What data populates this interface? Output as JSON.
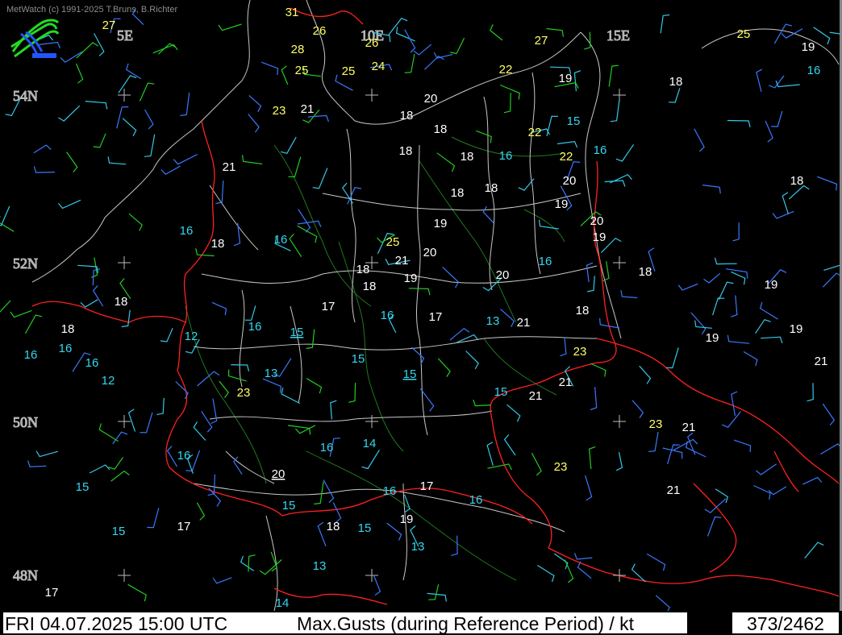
{
  "header": {
    "credit": "MetWatch  (c) 1991-2025 T.Bruns, B.Richter",
    "logo_icon": "metwatch-logo-icon"
  },
  "status_bar": {
    "datetime": "FRI 04.07.2025 15:00 UTC",
    "title": "Max.Gusts (during Reference Period) / kt",
    "counter": "373/2462"
  },
  "colors": {
    "background": "#000000",
    "border": "#ff2020",
    "coast": "#c8c8c8",
    "river": "#1f7a1f",
    "white_label": "#ffffff",
    "cyan_label": "#33d6f0",
    "yellow_label": "#ffff66",
    "barb_green": "#22cc22",
    "barb_blue": "#3a78ff",
    "barb_cyan": "#33c8e8"
  },
  "grid": {
    "lon_labels": [
      "5E",
      "10E",
      "15E"
    ],
    "lat_labels": [
      "54N",
      "52N",
      "50N",
      "48N"
    ]
  },
  "stations": [
    {
      "v": "31",
      "c": "y"
    },
    {
      "v": "27",
      "c": "y"
    },
    {
      "v": "26",
      "c": "y"
    },
    {
      "v": "26",
      "c": "y"
    },
    {
      "v": "27",
      "c": "y"
    },
    {
      "v": "25",
      "c": "y"
    },
    {
      "v": "19",
      "c": "w"
    },
    {
      "v": "28",
      "c": "y"
    },
    {
      "v": "25",
      "c": "y"
    },
    {
      "v": "25",
      "c": "y"
    },
    {
      "v": "24",
      "c": "y"
    },
    {
      "v": "22",
      "c": "y"
    },
    {
      "v": "16",
      "c": "c"
    },
    {
      "v": "19",
      "c": "w"
    },
    {
      "v": "18",
      "c": "w"
    },
    {
      "v": "20",
      "c": "w"
    },
    {
      "v": "23",
      "c": "y"
    },
    {
      "v": "21",
      "c": "w"
    },
    {
      "v": "18",
      "c": "w"
    },
    {
      "v": "15",
      "c": "c"
    },
    {
      "v": "18",
      "c": "w"
    },
    {
      "v": "22",
      "c": "y"
    },
    {
      "v": "18",
      "c": "w"
    },
    {
      "v": "18",
      "c": "w"
    },
    {
      "v": "16",
      "c": "c"
    },
    {
      "v": "22",
      "c": "y"
    },
    {
      "v": "16",
      "c": "c"
    },
    {
      "v": "21",
      "c": "w"
    },
    {
      "v": "20",
      "c": "w"
    },
    {
      "v": "18",
      "c": "w"
    },
    {
      "v": "18",
      "c": "w"
    },
    {
      "v": "18",
      "c": "w"
    },
    {
      "v": "19",
      "c": "w"
    },
    {
      "v": "19",
      "c": "w"
    },
    {
      "v": "20",
      "c": "w"
    },
    {
      "v": "16",
      "c": "c"
    },
    {
      "v": "19",
      "c": "w"
    },
    {
      "v": "18",
      "c": "w"
    },
    {
      "v": "16",
      "c": "c"
    },
    {
      "v": "25",
      "c": "y"
    },
    {
      "v": "20",
      "c": "w"
    },
    {
      "v": "21",
      "c": "w"
    },
    {
      "v": "18",
      "c": "w"
    },
    {
      "v": "16",
      "c": "c"
    },
    {
      "v": "18",
      "c": "w"
    },
    {
      "v": "20",
      "c": "w"
    },
    {
      "v": "18",
      "c": "w"
    },
    {
      "v": "19",
      "c": "w"
    },
    {
      "v": "19",
      "c": "w"
    },
    {
      "v": "18",
      "c": "w"
    },
    {
      "v": "17",
      "c": "w"
    },
    {
      "v": "16",
      "c": "c"
    },
    {
      "v": "17",
      "c": "w"
    },
    {
      "v": "13",
      "c": "c"
    },
    {
      "v": "21",
      "c": "w"
    },
    {
      "v": "18",
      "c": "w"
    },
    {
      "v": "18",
      "c": "w"
    },
    {
      "v": "19",
      "c": "w"
    },
    {
      "v": "19",
      "c": "w"
    },
    {
      "v": "16",
      "c": "c"
    },
    {
      "v": "15",
      "c": "c",
      "u": true
    },
    {
      "v": "12",
      "c": "c"
    },
    {
      "v": "16",
      "c": "c"
    },
    {
      "v": "16",
      "c": "c"
    },
    {
      "v": "16",
      "c": "c"
    },
    {
      "v": "15",
      "c": "c"
    },
    {
      "v": "23",
      "c": "y"
    },
    {
      "v": "21",
      "c": "w"
    },
    {
      "v": "13",
      "c": "c"
    },
    {
      "v": "15",
      "c": "c",
      "u": true
    },
    {
      "v": "12",
      "c": "c"
    },
    {
      "v": "21",
      "c": "w"
    },
    {
      "v": "23",
      "c": "y"
    },
    {
      "v": "15",
      "c": "c"
    },
    {
      "v": "21",
      "c": "w"
    },
    {
      "v": "23",
      "c": "y"
    },
    {
      "v": "21",
      "c": "w"
    },
    {
      "v": "16",
      "c": "c"
    },
    {
      "v": "14",
      "c": "c"
    },
    {
      "v": "16",
      "c": "c"
    },
    {
      "v": "23",
      "c": "y"
    },
    {
      "v": "20",
      "c": "w",
      "u": true
    },
    {
      "v": "15",
      "c": "c"
    },
    {
      "v": "16",
      "c": "c"
    },
    {
      "v": "17",
      "c": "w"
    },
    {
      "v": "21",
      "c": "w"
    },
    {
      "v": "16",
      "c": "c"
    },
    {
      "v": "15",
      "c": "c"
    },
    {
      "v": "19",
      "c": "w"
    },
    {
      "v": "18",
      "c": "w"
    },
    {
      "v": "15",
      "c": "c"
    },
    {
      "v": "17",
      "c": "w"
    },
    {
      "v": "15",
      "c": "c"
    },
    {
      "v": "13",
      "c": "c"
    },
    {
      "v": "13",
      "c": "c"
    },
    {
      "v": "17",
      "c": "w"
    },
    {
      "v": "14",
      "c": "c"
    }
  ]
}
